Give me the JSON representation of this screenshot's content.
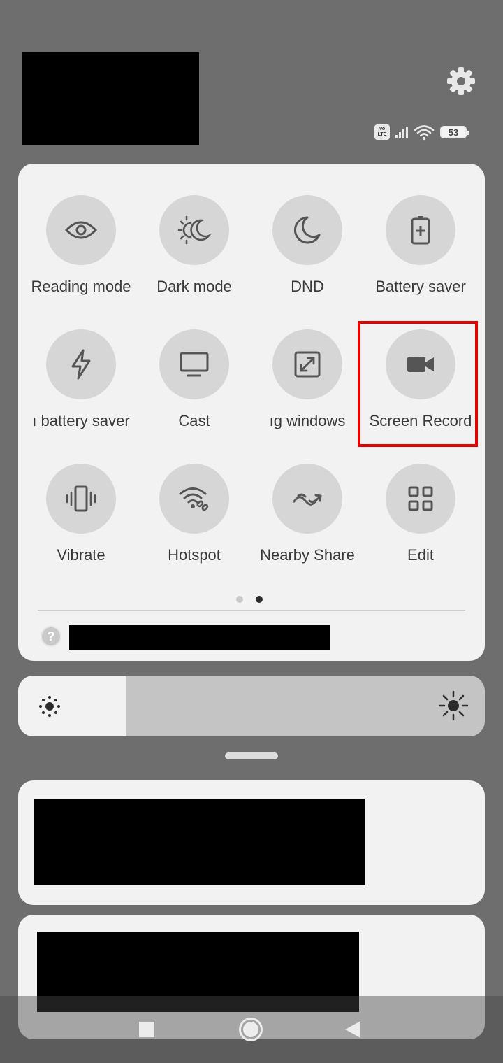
{
  "status": {
    "volte_top": "Vo",
    "volte_bottom": "LTE",
    "battery_level": "53",
    "signal_bars": 4,
    "wifi_strength": 4
  },
  "icons": {
    "settings": "gear-icon",
    "reading_mode": "eye-icon",
    "dark_mode": "sun-moon-icon",
    "dnd": "moon-icon",
    "battery_saver": "battery-plus-icon",
    "ultra_battery_saver": "lightning-icon",
    "cast": "monitor-icon",
    "floating_windows": "resize-icon",
    "screen_recorder": "video-camera-icon",
    "vibrate": "vibrate-icon",
    "hotspot": "hotspot-icon",
    "nearby_share": "nearby-share-icon",
    "edit": "grid-icon",
    "help": "question-icon",
    "brightness_low": "sun-low-icon",
    "brightness_high": "sun-high-icon"
  },
  "tiles": {
    "reading_mode": "Reading mode",
    "dark_mode": "Dark mode",
    "dnd": "DND",
    "battery_saver": "Battery saver",
    "ultra_battery_saver": "ı battery saver",
    "cast": "Cast",
    "floating_windows": "ıg windows",
    "screen_recorder": "Screen Record",
    "vibrate": "Vibrate",
    "hotspot": "Hotspot",
    "nearby_share": "Nearby Share",
    "edit": "Edit"
  },
  "pager": {
    "total": 2,
    "active": 2
  },
  "help": {
    "glyph": "?"
  },
  "brightness": {
    "level_percent": 23
  },
  "colors": {
    "highlight": "#e60000",
    "panel_bg": "#f2f2f2",
    "tile_bg": "#d6d6d6",
    "icon": "#555555",
    "backdrop": "#6e6e6e"
  }
}
